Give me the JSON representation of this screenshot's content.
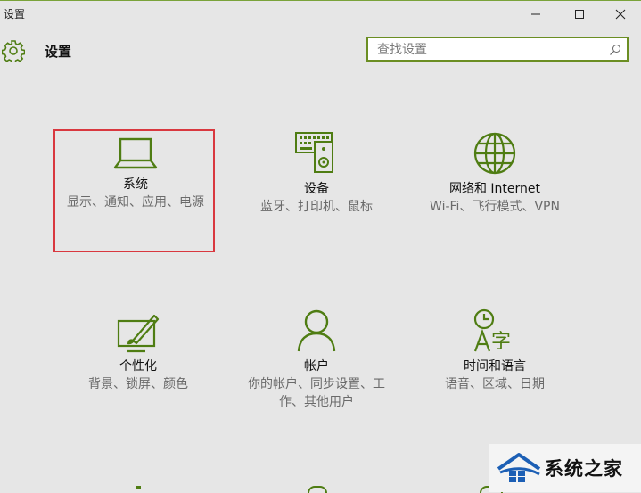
{
  "window": {
    "title": "设置",
    "minimize_icon": "minimize-icon",
    "maximize_icon": "maximize-icon",
    "close_icon": "close-icon"
  },
  "header": {
    "title": "设置",
    "icon": "gear-icon"
  },
  "search": {
    "placeholder": "查找设置",
    "value": ""
  },
  "tiles": [
    {
      "title": "系统",
      "desc": "显示、通知、应用、电源",
      "icon": "laptop-icon",
      "selected": true
    },
    {
      "title": "设备",
      "desc": "蓝牙、打印机、鼠标",
      "icon": "devices-icon"
    },
    {
      "title": "网络和 Internet",
      "desc": "Wi-Fi、飞行模式、VPN",
      "icon": "globe-icon"
    },
    {
      "title": "个性化",
      "desc": "背景、锁屏、颜色",
      "icon": "personalization-icon"
    },
    {
      "title": "帐户",
      "desc": "你的帐户、同步设置、工作、其他用户",
      "icon": "person-icon"
    },
    {
      "title": "时间和语言",
      "desc": "语音、区域、日期",
      "icon": "time-language-icon"
    }
  ],
  "colors": {
    "accent": "#4f7d13",
    "selection": "#d9383f",
    "background": "#e6e6e6"
  },
  "watermark": {
    "text": "系统之家"
  }
}
